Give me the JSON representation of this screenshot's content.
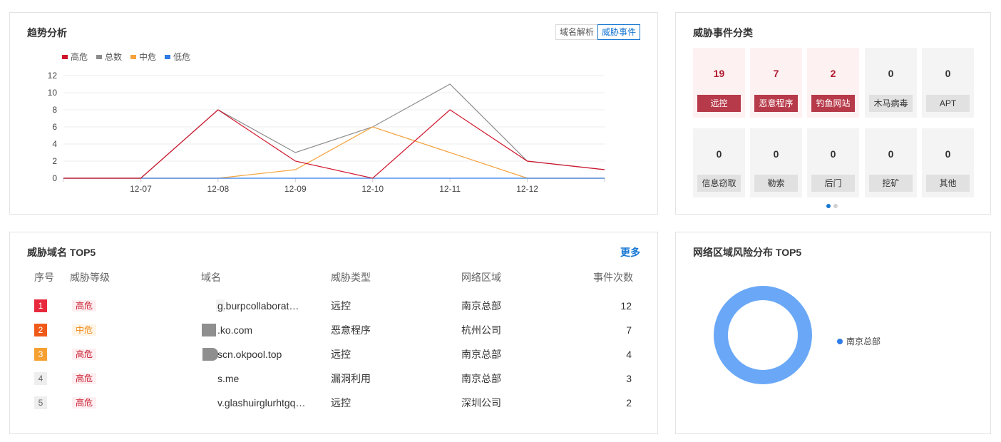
{
  "trend": {
    "title": "趋势分析",
    "toggle": [
      "域名解析",
      "威胁事件"
    ],
    "legend": [
      {
        "name": "高危",
        "color": "#d0142c"
      },
      {
        "name": "总数",
        "color": "#8c8c8c"
      },
      {
        "name": "中危",
        "color": "#f5a23c"
      },
      {
        "name": "低危",
        "color": "#2f7ce6"
      }
    ],
    "chart_data": {
      "type": "line",
      "x": [
        "",
        "12-07",
        "12-08",
        "12-09",
        "12-10",
        "12-11",
        "12-12",
        ""
      ],
      "ylim": [
        0,
        12
      ],
      "yticks": [
        "0",
        "2",
        "4",
        "6",
        "8",
        "10",
        "12"
      ],
      "series": [
        {
          "name": "总数",
          "color": "#8c8c8c",
          "values": [
            0,
            0,
            8,
            3,
            6,
            11,
            2,
            1
          ]
        },
        {
          "name": "中危",
          "color": "#f5a23c",
          "values": [
            0,
            0,
            0,
            1,
            6,
            3,
            0,
            0
          ]
        },
        {
          "name": "低危",
          "color": "#2f7ce6",
          "values": [
            0,
            0,
            0,
            0,
            0,
            0,
            0,
            0
          ]
        },
        {
          "name": "高危",
          "color": "#d0142c",
          "values": [
            0,
            0,
            8,
            2,
            0,
            8,
            2,
            1
          ]
        }
      ]
    }
  },
  "categories": {
    "title": "威胁事件分类",
    "items": [
      {
        "count": "19",
        "label": "远控",
        "red": true
      },
      {
        "count": "7",
        "label": "恶意程序",
        "red": true
      },
      {
        "count": "2",
        "label": "钓鱼网站",
        "red": true
      },
      {
        "count": "0",
        "label": "木马病毒",
        "red": false
      },
      {
        "count": "0",
        "label": "APT",
        "red": false
      },
      {
        "count": "0",
        "label": "信息窃取",
        "red": false
      },
      {
        "count": "0",
        "label": "勒索",
        "red": false
      },
      {
        "count": "0",
        "label": "后门",
        "red": false
      },
      {
        "count": "0",
        "label": "挖矿",
        "red": false
      },
      {
        "count": "0",
        "label": "其他",
        "red": false
      }
    ]
  },
  "top5": {
    "title": "威胁域名 TOP5",
    "more": "更多",
    "headers": [
      "序号",
      "威胁等级",
      "域名",
      "威胁类型",
      "网络区域",
      "事件次数"
    ],
    "rows": [
      {
        "rank": "1",
        "rank_color": "#e8283c",
        "level": "高危",
        "level_type": "high",
        "domain": "g.burpcollaborat…",
        "type": "远控",
        "region": "南京总部",
        "count": "12"
      },
      {
        "rank": "2",
        "rank_color": "#f05a18",
        "level": "中危",
        "level_type": "mid",
        "domain": ".ko.com",
        "type": "恶意程序",
        "region": "杭州公司",
        "count": "7"
      },
      {
        "rank": "3",
        "rank_color": "#f5a030",
        "level": "高危",
        "level_type": "high",
        "domain": "scn.okpool.top",
        "type": "远控",
        "region": "南京总部",
        "count": "4"
      },
      {
        "rank": "4",
        "rank_color": "#eeeeee",
        "level": "高危",
        "level_type": "high",
        "domain": "s.me",
        "type": "漏洞利用",
        "region": "南京总部",
        "count": "3"
      },
      {
        "rank": "5",
        "rank_color": "#eeeeee",
        "level": "高危",
        "level_type": "high",
        "domain": "v.glashuirglurhtgq…",
        "type": "远控",
        "region": "深圳公司",
        "count": "2"
      }
    ]
  },
  "region": {
    "title": "网络区域风险分布 TOP5",
    "chart_data": {
      "type": "pie",
      "labels": [
        "南京总部"
      ],
      "values": [
        1
      ],
      "colors": [
        "#6aa8f7"
      ]
    },
    "legend": "南京总部"
  }
}
